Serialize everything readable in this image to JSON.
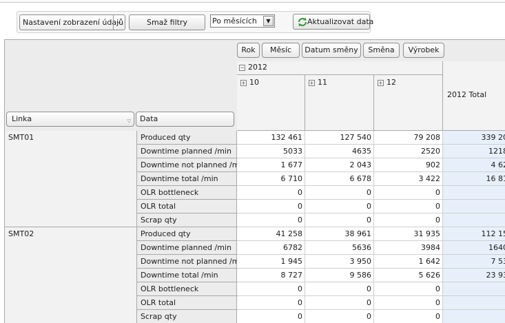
{
  "toolbar": {
    "view_settings_label": "Nastavení zobrazení údajů",
    "clear_filters_label": "Smaž filtry",
    "period_select_value": "Po měsících",
    "refresh_label": "Aktualizovat data"
  },
  "column_fields": [
    "Rok",
    "Měsíc",
    "Datum směny",
    "Směna",
    "Výrobek"
  ],
  "row_fields": {
    "line": "Linka",
    "data": "Data"
  },
  "columns": {
    "year": "2012",
    "months": [
      "10",
      "11",
      "12"
    ],
    "total_label": "2012 Total"
  },
  "groups": [
    {
      "name": "SMT01",
      "rows": [
        {
          "label": "Produced qty",
          "values": [
            "132 461",
            "127 540",
            "79 208"
          ],
          "total": "339 20"
        },
        {
          "label": "Downtime planned /min",
          "values": [
            "5033",
            "4635",
            "2520"
          ],
          "total": "1218"
        },
        {
          "label": "Downtime not planned /min",
          "values": [
            "1 677",
            "2 043",
            "902"
          ],
          "total": "4 62"
        },
        {
          "label": "Downtime total /min",
          "values": [
            "6 710",
            "6 678",
            "3 422"
          ],
          "total": "16 81"
        },
        {
          "label": "OLR bottleneck",
          "values": [
            "0",
            "0",
            "0"
          ],
          "total": ""
        },
        {
          "label": "OLR total",
          "values": [
            "0",
            "0",
            "0"
          ],
          "total": ""
        },
        {
          "label": "Scrap qty",
          "values": [
            "0",
            "0",
            "0"
          ],
          "total": ""
        }
      ]
    },
    {
      "name": "SMT02",
      "rows": [
        {
          "label": "Produced qty",
          "values": [
            "41 258",
            "38 961",
            "31 935"
          ],
          "total": "112 15"
        },
        {
          "label": "Downtime planned /min",
          "values": [
            "6782",
            "5636",
            "3984"
          ],
          "total": "1640"
        },
        {
          "label": "Downtime not planned /min",
          "values": [
            "1 945",
            "3 950",
            "1 642"
          ],
          "total": "7 53"
        },
        {
          "label": "Downtime total /min",
          "values": [
            "8 727",
            "9 586",
            "5 626"
          ],
          "total": "23 93"
        },
        {
          "label": "OLR bottleneck",
          "values": [
            "0",
            "0",
            "0"
          ],
          "total": ""
        },
        {
          "label": "OLR total",
          "values": [
            "0",
            "0",
            "0"
          ],
          "total": ""
        },
        {
          "label": "Scrap qty",
          "values": [
            "0",
            "0",
            "0"
          ],
          "total": ""
        }
      ]
    }
  ]
}
